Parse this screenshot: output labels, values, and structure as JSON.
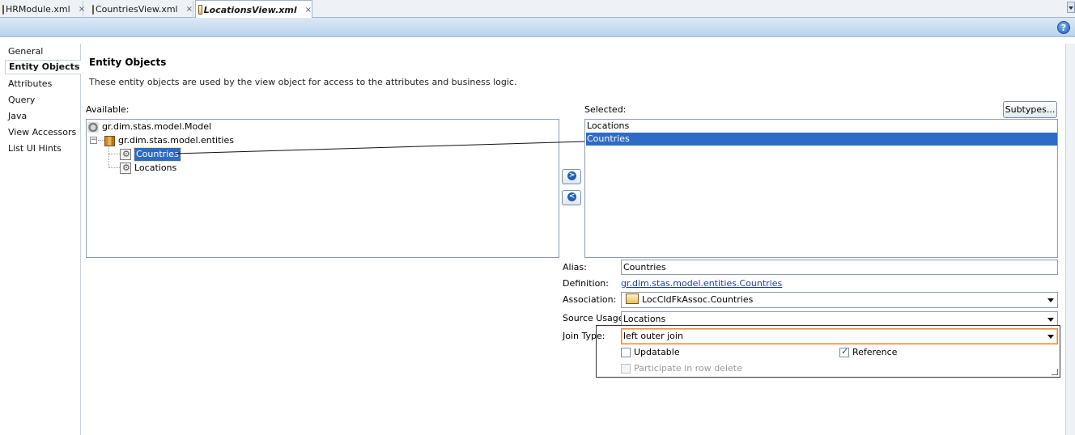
{
  "tabs": [
    {
      "label": "HRModule.xml",
      "close": "×"
    },
    {
      "label": "CountriesView.xml",
      "close": "×"
    },
    {
      "label": "LocationsView.xml",
      "close": "×"
    }
  ],
  "help_label": "?",
  "nav": [
    "General",
    "Entity Objects",
    "Attributes",
    "Query",
    "Java",
    "View Accessors",
    "List UI Hints"
  ],
  "main": {
    "title": "Entity Objects",
    "description": "These entity objects are used by the view object for access to the attributes and business logic."
  },
  "available": {
    "label": "Available:",
    "root": "gr.dim.stas.model.Model",
    "package": "gr.dim.stas.model.entities",
    "entities": [
      "Countries",
      "Locations"
    ]
  },
  "selected": {
    "label": "Selected:",
    "subtypes_button": "Subtypes...",
    "items": [
      "Locations",
      "Countries"
    ],
    "selected_index": 1
  },
  "shuttle": {
    "add": ">",
    "remove": "<"
  },
  "details": {
    "alias_label": "Alias:",
    "alias_value": "Countries",
    "definition_label": "Definition:",
    "definition_value": "gr.dim.stas.model.entities.Countries",
    "association_label": "Association:",
    "association_value": "LocCIdFkAssoc.Countries",
    "source_usage_label": "Source Usage:",
    "source_usage_value": "Locations",
    "join_type_label": "Join Type:",
    "join_type_value": "left outer join",
    "updatable_label": "Updatable",
    "updatable_checked": false,
    "reference_label": "Reference",
    "reference_checked": true,
    "participate_label": "Participate in row delete",
    "participate_checked": false
  }
}
